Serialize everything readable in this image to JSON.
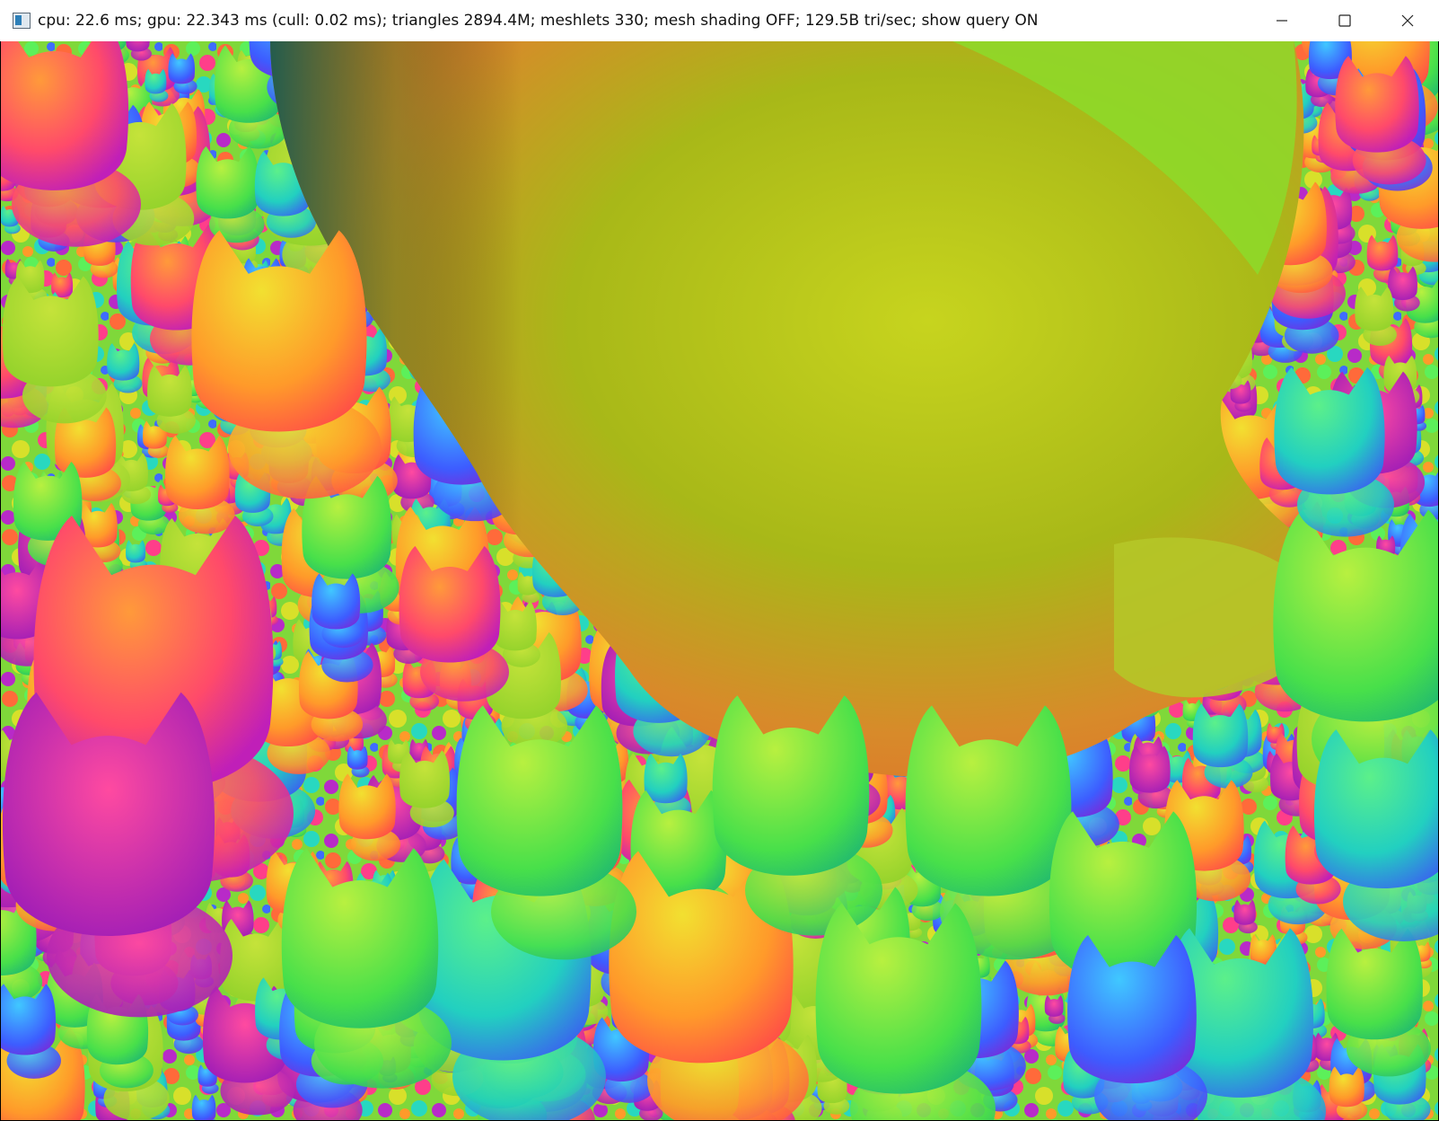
{
  "window": {
    "title": "cpu: 22.6 ms; gpu: 22.343 ms (cull: 0.02 ms); triangles 2894.4M; meshlets 330; mesh shading OFF; 129.5B tri/sec; show query ON",
    "icons": {
      "app": "app-window-icon",
      "minimize": "minimize-icon",
      "maximize": "maximize-icon",
      "close": "close-icon"
    }
  },
  "scene": {
    "description_icon": "rendered-3d-viewport",
    "palette": {
      "magenta": "#c81fc0",
      "pink": "#ff4c7a",
      "orange": "#ff8c2a",
      "yellow": "#d7d21c",
      "green": "#58e83a",
      "cyan": "#27d6c4",
      "blue": "#3f5cff",
      "dark-teal": "#1e5a4a"
    }
  }
}
